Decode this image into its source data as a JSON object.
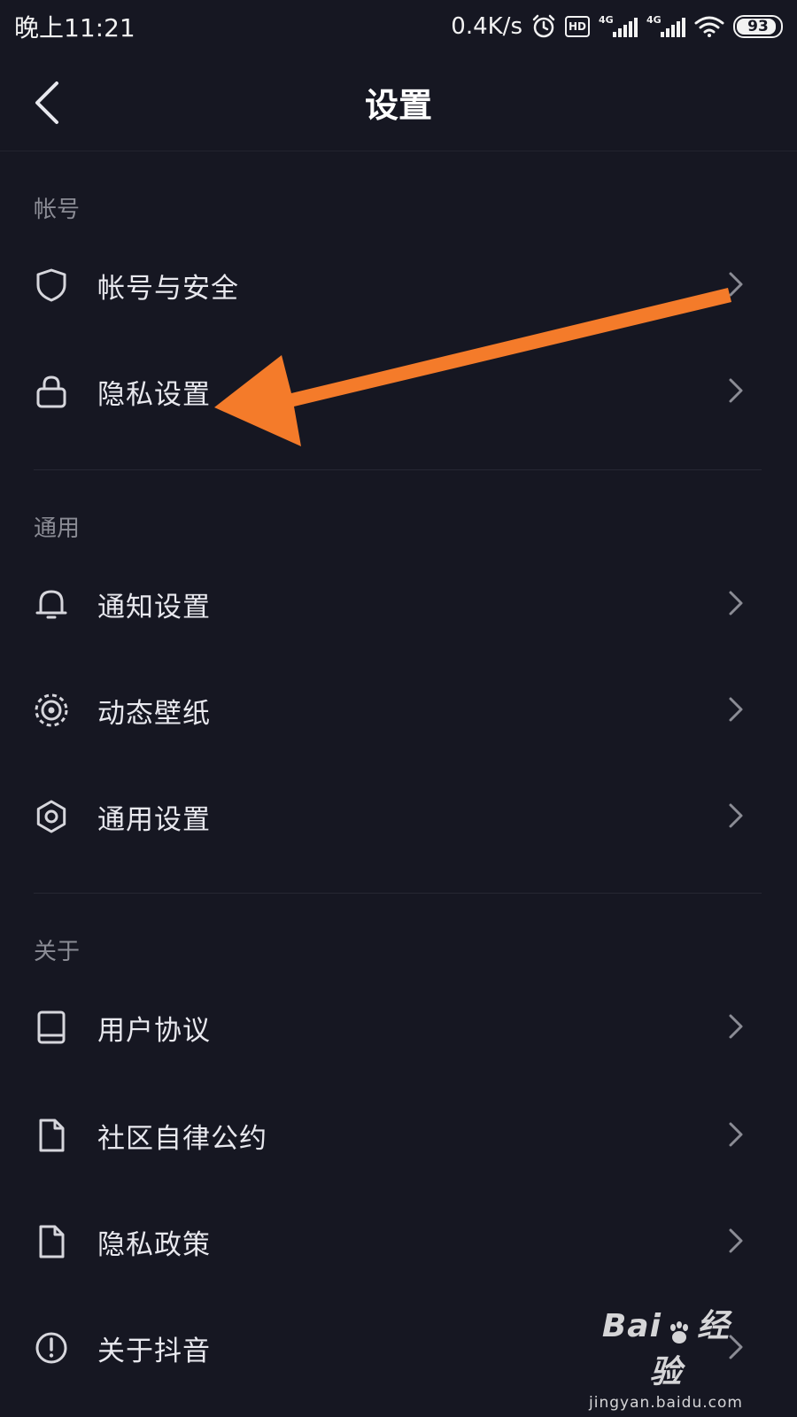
{
  "status_bar": {
    "time": "晚上11:21",
    "net_speed": "0.4K/s",
    "hd_label": "HD",
    "network_1": "4G",
    "network_2": "4G",
    "battery": "93",
    "battery_level": 0.93
  },
  "header": {
    "title": "设置"
  },
  "sections": [
    {
      "label": "帐号",
      "items": [
        {
          "label": "帐号与安全",
          "icon": "shield-icon"
        },
        {
          "label": "隐私设置",
          "icon": "lock-icon"
        }
      ]
    },
    {
      "label": "通用",
      "items": [
        {
          "label": "通知设置",
          "icon": "bell-icon"
        },
        {
          "label": "动态壁纸",
          "icon": "wallpaper-icon"
        },
        {
          "label": "通用设置",
          "icon": "gear-icon"
        }
      ]
    },
    {
      "label": "关于",
      "items": [
        {
          "label": "用户协议",
          "icon": "book-icon"
        },
        {
          "label": "社区自律公约",
          "icon": "document-icon"
        },
        {
          "label": "隐私政策",
          "icon": "document-icon"
        },
        {
          "label": "关于抖音",
          "icon": "info-icon"
        }
      ]
    }
  ],
  "colors": {
    "background": "#161722",
    "text": "#e8e8ee",
    "section_label": "#8b8c95",
    "annotation_arrow": "#f47b2a"
  },
  "watermark": {
    "brand_left": "Bai",
    "brand_right": "经验",
    "url": "jingyan.baidu.com"
  }
}
